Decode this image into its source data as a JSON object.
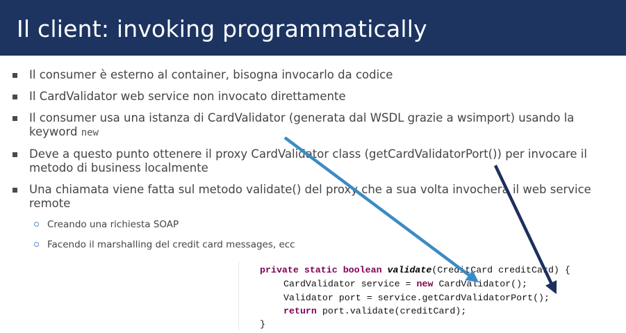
{
  "slide": {
    "title": "Il client: invoking programmatically",
    "bullets": [
      {
        "text": "Il consumer è esterno al container, bisogna invocarlo da codice"
      },
      {
        "text": "Il CardValidator web service non invocato direttamente"
      },
      {
        "text": "Il consumer usa una istanza di CardValidator (generata dal WSDL grazie a  wsimport) usando la keyword ",
        "code": "new"
      },
      {
        "text": "Deve a questo punto ottenere il proxy CardValidator class (getCardValidatorPort()) per invocare il metodo di business localmente"
      },
      {
        "text": "Una chiamata viene fatta sul metodo validate() del proxy che a sua volta invocherà il web service remote"
      }
    ],
    "sub_bullets": [
      "Creando una richiesta SOAP",
      "Facendo il marshalling del credit card messages, ecc"
    ]
  },
  "code": {
    "l1_kw": "private static boolean ",
    "l1_method": "validate",
    "l1_rest": "(CreditCard creditCard) {",
    "l2_a": "CardValidator service = ",
    "l2_kw": "new",
    "l2_b": " CardValidator();",
    "l3": "Validator port = service.getCardValidatorPort();",
    "l4_kw": "return",
    "l4_b": " port.validate(creditCard);",
    "l5": "}"
  },
  "colors": {
    "header_bg": "#1d3461",
    "arrow_light": "#3b8bc4",
    "arrow_dark": "#1d2f5e"
  }
}
